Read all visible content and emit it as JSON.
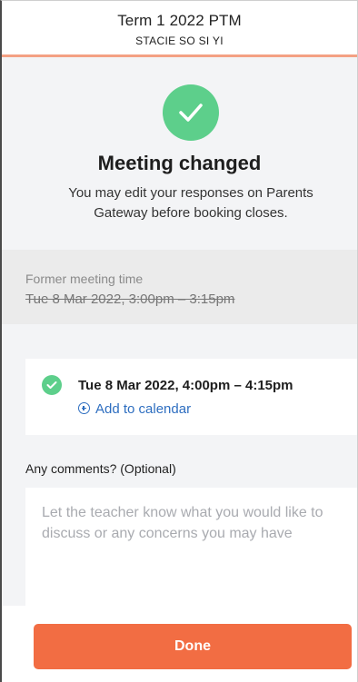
{
  "header": {
    "title": "Term 1 2022 PTM",
    "subtitle": "STACIE SO SI YI"
  },
  "hero": {
    "icon": "check-circle-icon",
    "heading": "Meeting changed",
    "description": "You may edit your responses on Parents Gateway before booking closes."
  },
  "former_meeting": {
    "label": "Former meeting time",
    "time": "Tue 8 Mar 2022, 3:00pm – 3:15pm"
  },
  "new_meeting": {
    "icon": "check-circle-icon",
    "time": "Tue 8 Mar 2022, 4:00pm – 4:15pm",
    "add_to_calendar": "Add to calendar"
  },
  "comments": {
    "label": "Any comments? (Optional)",
    "placeholder": "Let the teacher know what you would like to discuss or any concerns you may have",
    "value": ""
  },
  "footer": {
    "done_label": "Done"
  },
  "colors": {
    "accent": "#f26d43",
    "success": "#5dcf8b",
    "link": "#2e6ec0",
    "header_line": "#f4a083"
  }
}
